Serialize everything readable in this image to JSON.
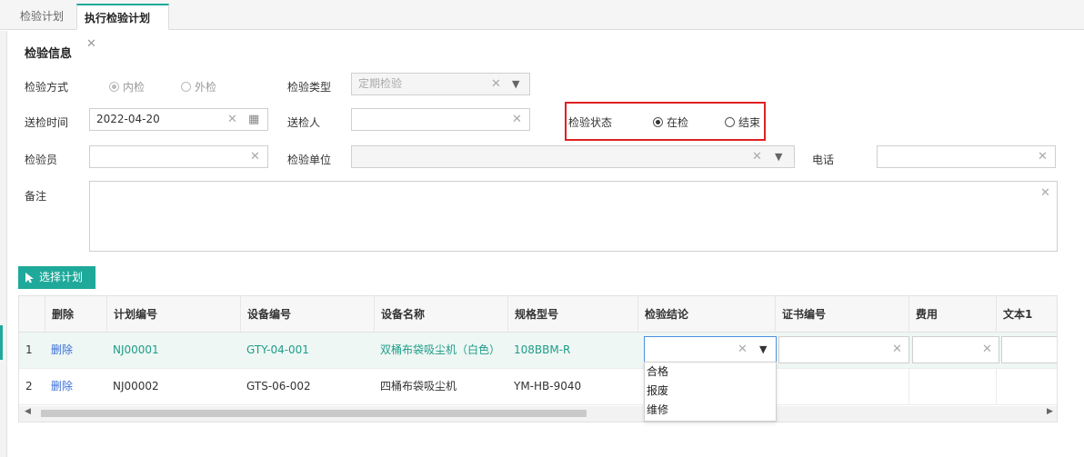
{
  "tabs": [
    {
      "label": "检验计划"
    },
    {
      "label": "执行检验计划",
      "close": "✕"
    }
  ],
  "section_title": "检验信息",
  "form": {
    "method": {
      "label": "检验方式",
      "options": [
        "内检",
        "外检"
      ]
    },
    "type": {
      "label": "检验类型",
      "value": "定期检验"
    },
    "send_time": {
      "label": "送检时间",
      "value": "2022-04-20"
    },
    "sender": {
      "label": "送检人",
      "value": ""
    },
    "status": {
      "label": "检验状态",
      "options": [
        "在检",
        "结束"
      ]
    },
    "inspector": {
      "label": "检验员",
      "value": ""
    },
    "unit": {
      "label": "检验单位",
      "value": ""
    },
    "phone": {
      "label": "电话",
      "value": ""
    },
    "remark": {
      "label": "备注",
      "value": ""
    }
  },
  "select_plan_button": "选择计划",
  "grid": {
    "columns": [
      "删除",
      "计划编号",
      "设备编号",
      "设备名称",
      "规格型号",
      "检验结论",
      "证书编号",
      "费用",
      "文本1"
    ],
    "rows": [
      {
        "index": "1",
        "delete": "删除",
        "plan_no": "NJ00001",
        "device_no": "GTY-04-001",
        "device_name": "双桶布袋吸尘机（白色）",
        "spec": "108BBM-R"
      },
      {
        "index": "2",
        "delete": "删除",
        "plan_no": "NJ00002",
        "device_no": "GTS-06-002",
        "device_name": "四桶布袋吸尘机",
        "spec": "YM-HB-9040"
      }
    ]
  },
  "conclusion_options": [
    "合格",
    "报废",
    "维修"
  ],
  "colors": {
    "accent": "#1ea99a",
    "highlight": "#e02020",
    "link": "#3a6fd8"
  }
}
